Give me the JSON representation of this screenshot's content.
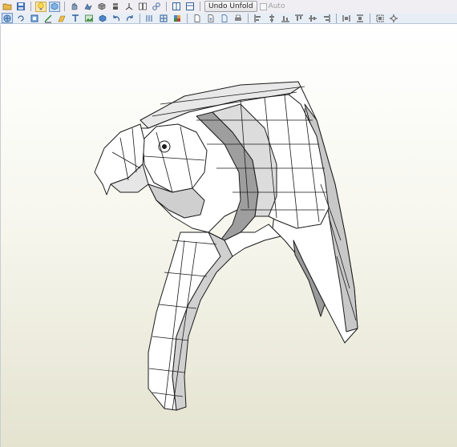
{
  "toolbar_top": {
    "icons": [
      "open-folder-icon",
      "save-icon",
      "lightbulb-icon",
      "cube-link-icon",
      "hand-rotate-icon",
      "pan-icon",
      "cube-shaded-icon",
      "cube-stack-icon",
      "axis-icon",
      "split-view-icon",
      "linked-view-icon",
      "single-window-icon",
      "dual-window-icon"
    ],
    "undo_unfold_label": "Undo Unfold",
    "auto_label": "Auto",
    "auto_checked": false
  },
  "toolbar_bottom": {
    "icons": [
      "select-icon",
      "rotate-view-icon",
      "move-part-icon",
      "edge-icon",
      "flap-icon",
      "text-icon",
      "image-icon",
      "join-icon",
      "undo-icon",
      "redo-icon",
      "edge-list-icon",
      "grid-icon",
      "color-palette-icon",
      "page-icon",
      "page-setup-icon",
      "export-icon",
      "print-icon",
      "align-left-icon",
      "align-center-icon",
      "align-bottom-icon",
      "align-top-icon",
      "align-middle-icon",
      "align-right-icon",
      "distribute-h-icon",
      "distribute-v-icon",
      "fit-icon",
      "arrange-icon"
    ]
  },
  "viewport": {
    "model": "3D papercraft bird-head mesh",
    "background_top": "#ffffff",
    "background_bottom": "#e4e3d0"
  },
  "colors": {
    "mesh_light": "#ffffff",
    "mesh_mid": "#d6d6d6",
    "mesh_dark": "#9c9c9c",
    "edge": "#1a1a1a"
  }
}
